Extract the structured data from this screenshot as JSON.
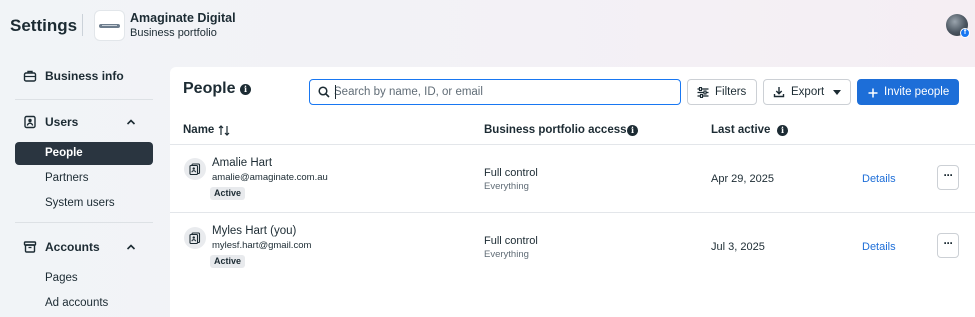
{
  "header": {
    "title": "Settings",
    "business_name": "Amaginate Digital",
    "business_sub": "Business portfolio"
  },
  "sidebar": {
    "business_info": "Business info",
    "users": {
      "label": "Users",
      "items": [
        "People",
        "Partners",
        "System users"
      ]
    },
    "accounts": {
      "label": "Accounts",
      "items": [
        "Pages",
        "Ad accounts"
      ]
    },
    "selected": "People"
  },
  "main": {
    "title": "People",
    "search_placeholder": "Search by name, ID, or email",
    "filters_label": "Filters",
    "export_label": "Export",
    "invite_label": "Invite people",
    "columns": {
      "name": "Name",
      "access": "Business portfolio access",
      "last_active": "Last active"
    },
    "rows": [
      {
        "name": "Amalie Hart",
        "email": "amalie@amaginate.com.au",
        "status": "Active",
        "access": "Full control",
        "access_sub": "Everything",
        "last_active": "Apr 29, 2025",
        "details": "Details",
        "more": "···"
      },
      {
        "name": "Myles Hart (you)",
        "email": "mylesf.hart@gmail.com",
        "status": "Active",
        "access": "Full control",
        "access_sub": "Everything",
        "last_active": "Jul 3, 2025",
        "details": "Details",
        "more": "···"
      }
    ]
  },
  "colors": {
    "primary": "#1d6ed8",
    "text": "#1c2b33",
    "selected_bg": "#2a3540"
  },
  "icons": {
    "info": "i",
    "facebook_badge": "f"
  }
}
